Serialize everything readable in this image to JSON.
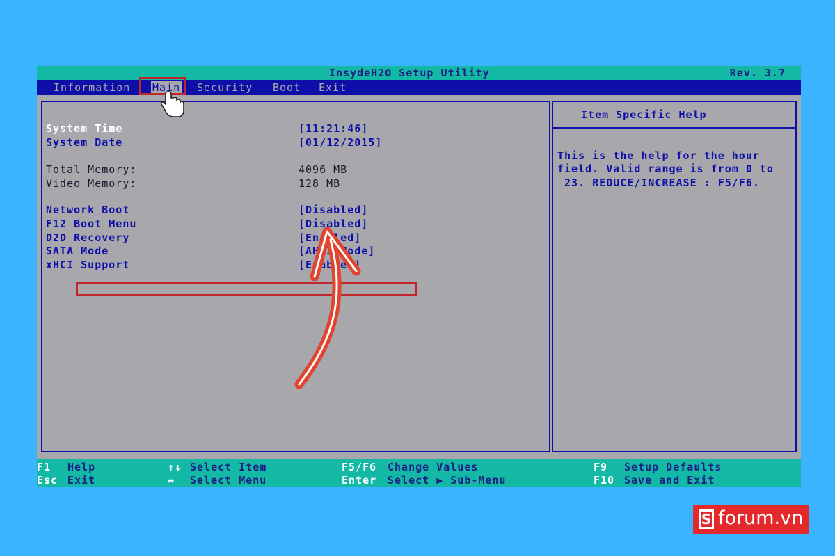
{
  "app": {
    "title": "InsydeH2O Setup Utility",
    "revision": "Rev. 3.7"
  },
  "menu": {
    "items": [
      "Information",
      "Main",
      "Security",
      "Boot",
      "Exit"
    ],
    "active": "Main"
  },
  "main": {
    "rows": [
      {
        "label": "System Time",
        "value": "[11:21:46]"
      },
      {
        "label": "System Date",
        "value": "[01/12/2015]"
      },
      {
        "label": "Total Memory:",
        "value": "4096 MB"
      },
      {
        "label": "Video Memory:",
        "value": "128 MB"
      },
      {
        "label": "Network Boot",
        "value": "[Disabled]"
      },
      {
        "label": "F12 Boot Menu",
        "value": "[Disabled]"
      },
      {
        "label": "D2D Recovery",
        "value": "[Enabled]"
      },
      {
        "label": "SATA Mode",
        "value": "[AHCI Mode]"
      },
      {
        "label": "xHCI Support",
        "value": "[Enabled]"
      }
    ]
  },
  "help": {
    "title": "Item Specific Help",
    "lines": [
      "This is the help for the hour",
      "field. Valid range is from 0 to",
      " 23. REDUCE/INCREASE : F5/F6."
    ]
  },
  "footer": {
    "f1_key": "F1",
    "f1_label": "Help",
    "esc_key": "Esc",
    "esc_label": "Exit",
    "updown_key": "↑↓",
    "updown_label": "Select Item",
    "leftright_key": "↔",
    "leftright_label": "Select Menu",
    "f5f6_key": "F5/F6",
    "f5f6_label": "Change Values",
    "enter_key": "Enter",
    "enter_label": "Select ▶ Sub-Menu",
    "f9_key": "F9",
    "f9_label": "Setup Defaults",
    "f10_key": "F10",
    "f10_label": "Save and Exit"
  },
  "watermark": {
    "text": "forum.vn",
    "mark": "S"
  },
  "colors": {
    "background": "#3ab4ff",
    "bios_gray": "#a8a8ac",
    "bios_blue": "#0e0ea8",
    "bios_teal": "#14b9a6",
    "annotation_red": "#c0272d",
    "logo_red": "#e3292b"
  }
}
